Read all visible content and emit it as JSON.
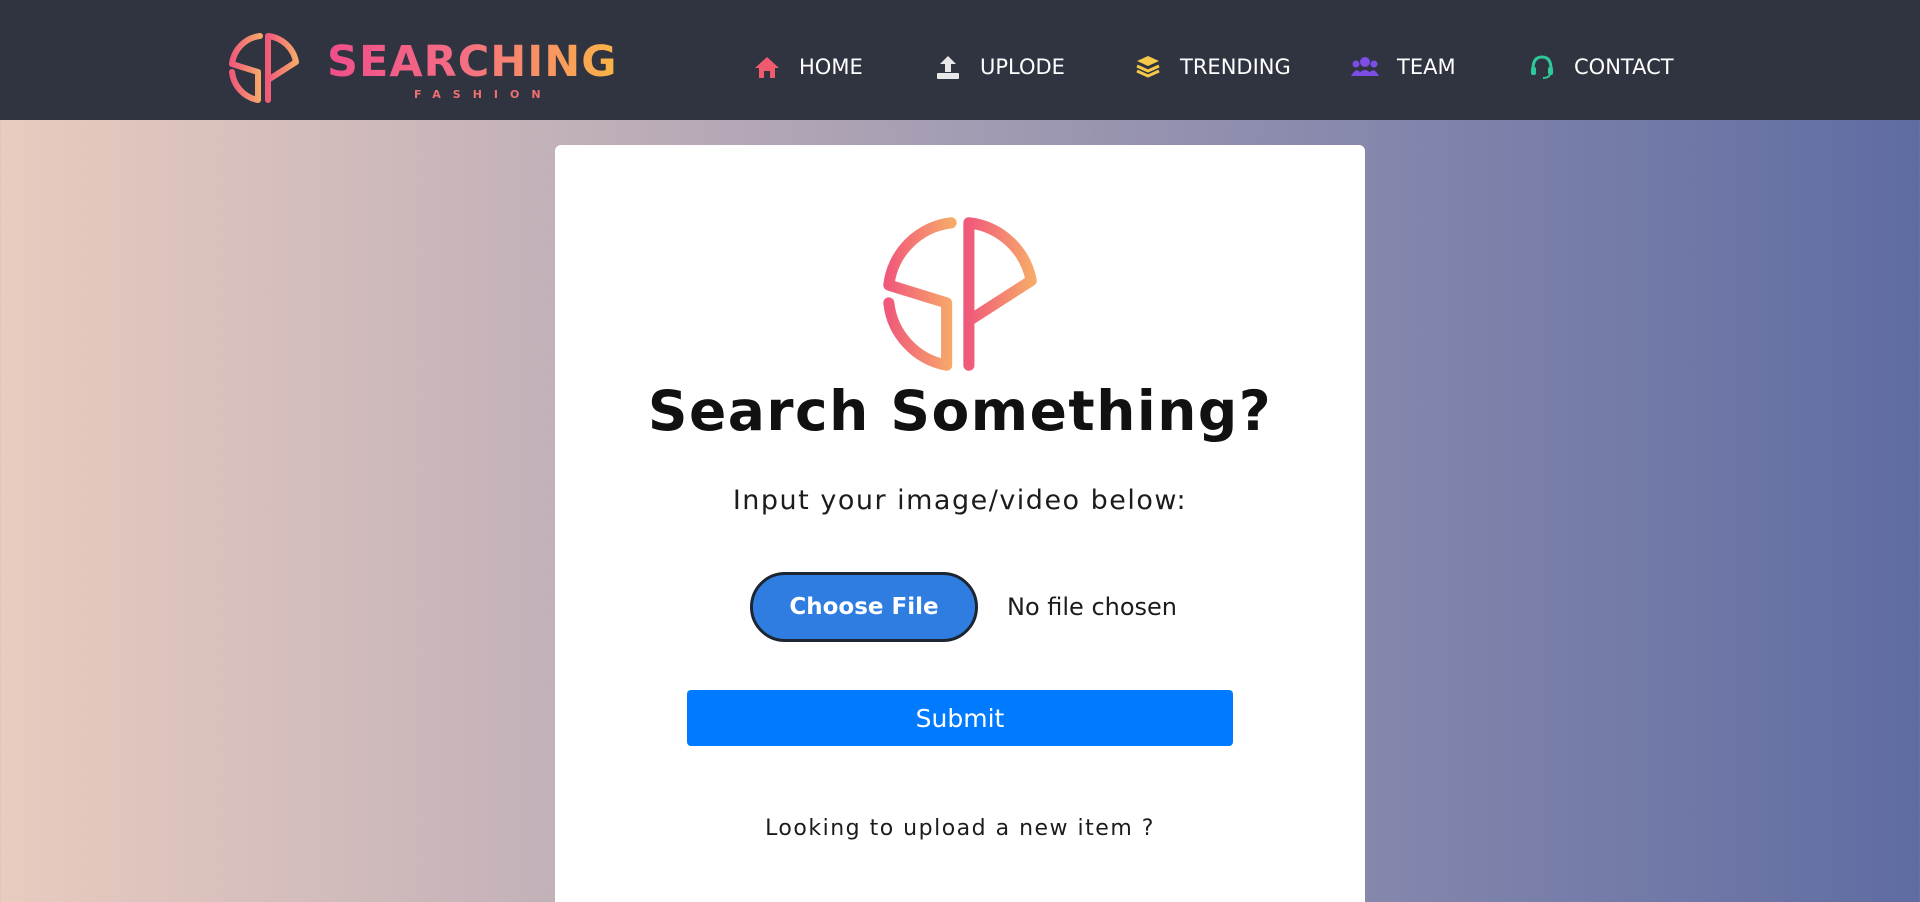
{
  "brand": {
    "name": "SEARCHING",
    "tagline": "FASHION",
    "gradient_start": "#ef4e8a",
    "gradient_end": "#fbb545"
  },
  "nav": {
    "items": [
      {
        "label": "HOME",
        "icon": "home-icon",
        "color": "#f05a6e"
      },
      {
        "label": "UPLODE",
        "icon": "upload-icon",
        "color": "#ffffff"
      },
      {
        "label": "TRENDING",
        "icon": "layers-icon",
        "color": "#f7c948"
      },
      {
        "label": "TEAM",
        "icon": "users-icon",
        "color": "#7d4de6"
      },
      {
        "label": "CONTACT",
        "icon": "headset-icon",
        "color": "#2ec89a"
      }
    ]
  },
  "card": {
    "title": "Search Something?",
    "subtitle": "Input your image/video below:",
    "choose_file_label": "Choose File",
    "file_status": "No file chosen",
    "submit_label": "Submit",
    "upload_prompt": "Looking to upload a new item ?"
  },
  "colors": {
    "navbar": "#2f3440",
    "choose_button": "#2f7de1",
    "submit_button": "#007bff"
  }
}
